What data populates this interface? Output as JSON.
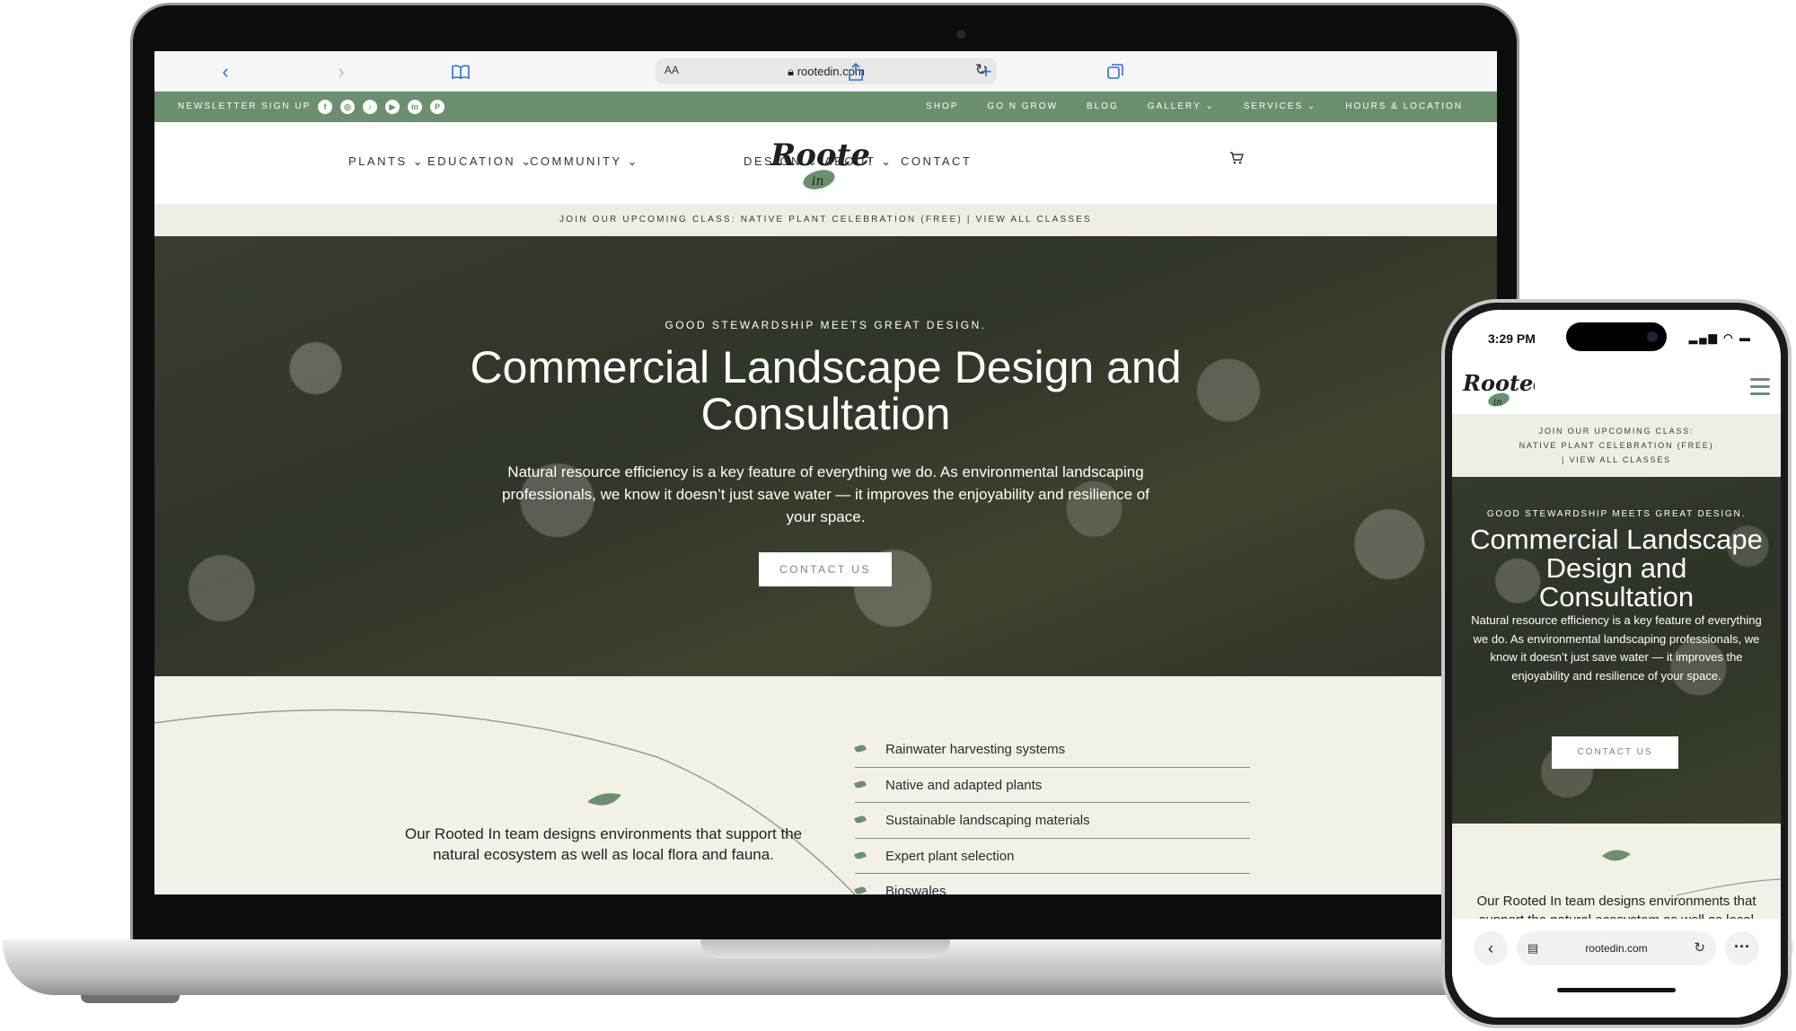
{
  "browser": {
    "text_size_label": "AA",
    "url": "rootedin.com"
  },
  "topbar": {
    "newsletter": "NEWSLETTER SIGN UP",
    "social_icons": [
      "facebook-icon",
      "instagram-icon",
      "tiktok-icon",
      "youtube-icon",
      "linkedin-icon",
      "pinterest-icon"
    ],
    "links": [
      "SHOP",
      "GO N GROW",
      "BLOG",
      "GALLERY ⌄",
      "SERVICES ⌄",
      "HOURS & LOCATION"
    ]
  },
  "nav": {
    "plants": "PLANTS ⌄",
    "education": "EDUCATION ⌄",
    "community": "COMMUNITY ⌄",
    "design": "DESIGN ⌄",
    "about": "ABOUT ⌄",
    "contact": "CONTACT"
  },
  "logo": {
    "text": "Rooted",
    "sub": "in"
  },
  "announcement": "JOIN OUR UPCOMING CLASS:  NATIVE PLANT CELEBRATION (FREE)  |  VIEW ALL CLASSES",
  "hero": {
    "kicker": "GOOD STEWARDSHIP MEETS GREAT DESIGN.",
    "title": "Commercial Landscape Design and Consultation",
    "body": "Natural resource efficiency is a key feature of everything we do. As environmental landscaping professionals, we know it doesn’t just save water — it improves the enjoyability and resilience of your space.",
    "button": "CONTACT US"
  },
  "lower": {
    "text": "Our Rooted In team designs environments that support the natural ecosystem as well as local flora and fauna.",
    "features": [
      "Rainwater harvesting systems",
      "Native and adapted plants",
      "Sustainable landscaping materials",
      "Expert plant selection",
      "Bioswales"
    ]
  },
  "phone": {
    "time": "3:29 PM",
    "status_icons": "▂▄▆ ◠ ▬",
    "announce_line1": "JOIN OUR UPCOMING CLASS:",
    "announce_line2": "NATIVE PLANT CELEBRATION (FREE)",
    "announce_line3": "|  VIEW ALL CLASSES",
    "kicker": "GOOD STEWARDSHIP MEETS GREAT DESIGN.",
    "title": "Commercial Landscape Design and Consultation",
    "body": "Natural resource efficiency is a key feature of everything we do. As environmental landscaping professionals, we know it doesn’t just save water — it improves the enjoyability and resilience of your space.",
    "button": "CONTACT US",
    "lower_text": "Our Rooted In team designs environments that support the natural ecosystem as well as local flora and fauna. We often look to",
    "url": "rootedin.com"
  },
  "colors": {
    "brand_green": "#6b8f6f",
    "cream": "#f3f0e8",
    "announce_bg": "#f0ede4"
  }
}
